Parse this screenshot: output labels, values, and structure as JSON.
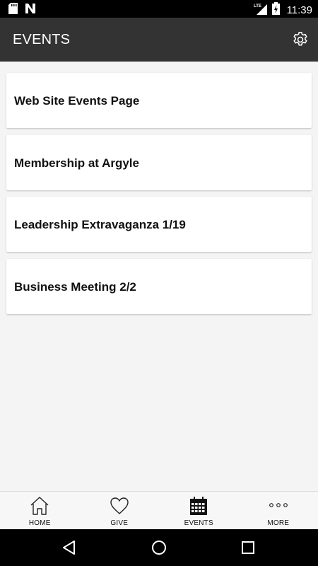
{
  "status_bar": {
    "time": "11:39",
    "network": "LTE",
    "icons": [
      "sd-card-icon",
      "n-notification-icon",
      "lte-signal-icon",
      "battery-charging-icon"
    ]
  },
  "app_bar": {
    "title": "EVENTS",
    "settings_icon": "gear-icon"
  },
  "events": [
    {
      "title": "Web Site Events Page"
    },
    {
      "title": "Membership at Argyle"
    },
    {
      "title": "Leadership Extravaganza 1/19"
    },
    {
      "title": "Business Meeting 2/2"
    }
  ],
  "bottom_nav": {
    "items": [
      {
        "label": "HOME",
        "icon": "home-icon"
      },
      {
        "label": "GIVE",
        "icon": "heart-icon"
      },
      {
        "label": "EVENTS",
        "icon": "calendar-icon",
        "active": true
      },
      {
        "label": "MORE",
        "icon": "more-dots-icon"
      }
    ]
  },
  "system_nav": {
    "buttons": [
      "back-icon",
      "home-circle-icon",
      "recents-icon"
    ]
  },
  "colors": {
    "app_bar": "#333333",
    "background": "#f4f4f4",
    "card": "#ffffff",
    "status_bar": "#000000"
  }
}
